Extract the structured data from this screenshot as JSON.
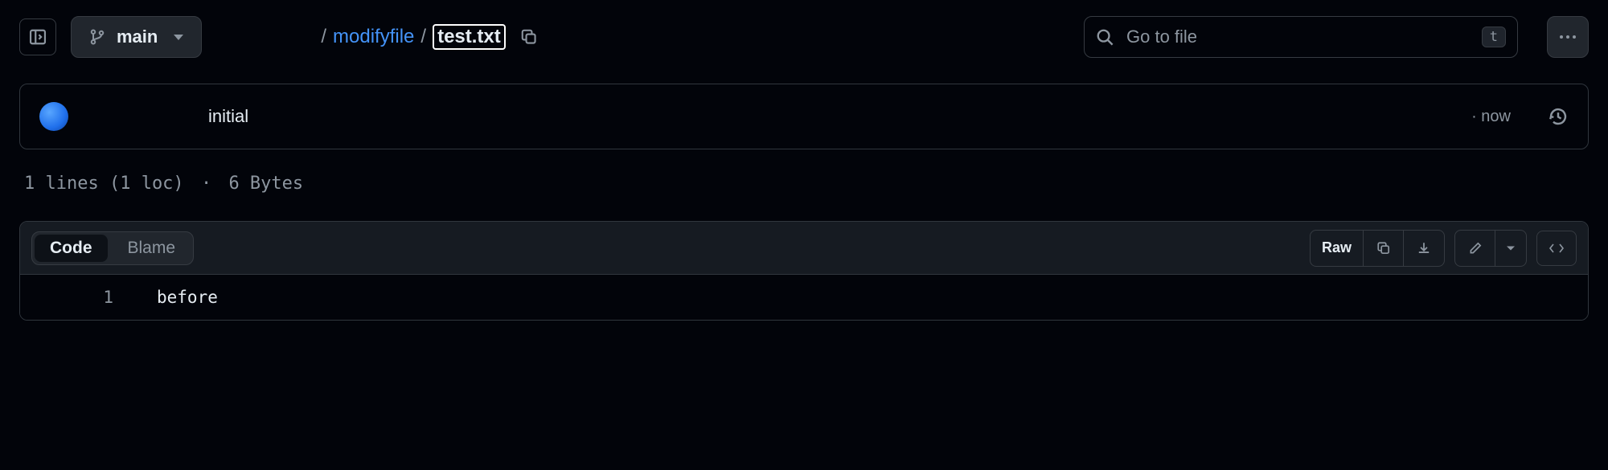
{
  "branch": {
    "name": "main"
  },
  "breadcrumb": {
    "parent": "modifyfile",
    "current": "test.txt"
  },
  "search": {
    "placeholder": "Go to file",
    "shortcut": "t"
  },
  "commit": {
    "message": "initial",
    "time_prefix": "·",
    "time": "now"
  },
  "stats": {
    "lines": "1 lines (1 loc)",
    "separator": "·",
    "size": "6 Bytes"
  },
  "tabs": {
    "code": "Code",
    "blame": "Blame"
  },
  "toolbar": {
    "raw": "Raw"
  },
  "file": {
    "lines": [
      {
        "n": "1",
        "text": "before"
      }
    ]
  }
}
